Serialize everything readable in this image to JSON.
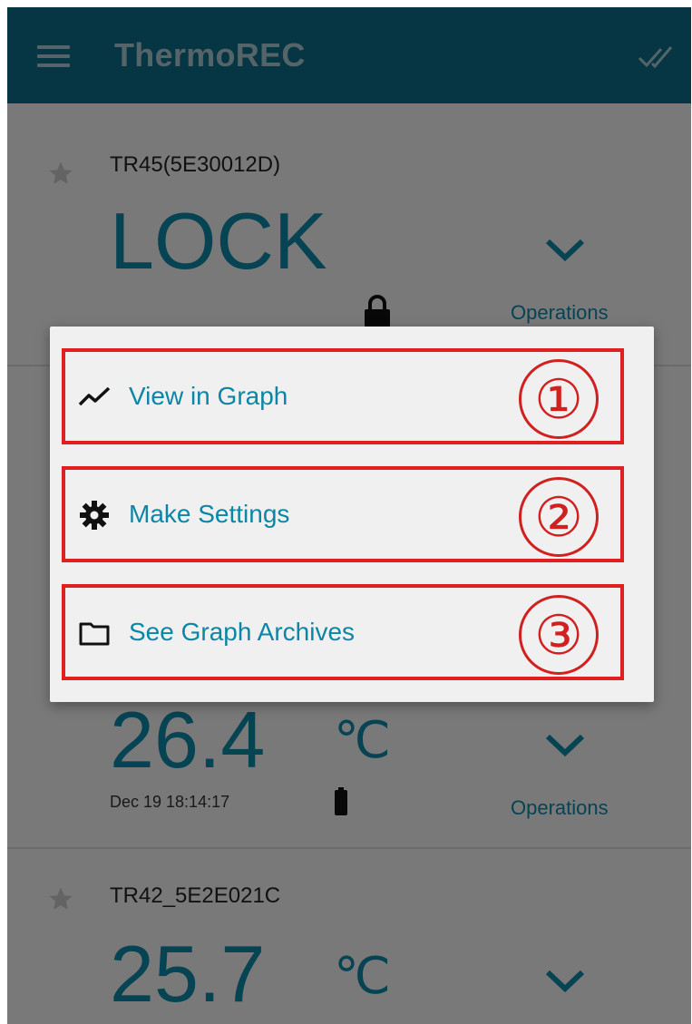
{
  "app": {
    "title": "ThermoREC",
    "icons": {
      "menu": "hamburger-icon",
      "sync": "double-check-icon"
    }
  },
  "devices": [
    {
      "name": "TR45(5E30012D)",
      "value": "LOCK",
      "unit": "",
      "timestamp": "",
      "status_icon": "lock-icon",
      "operations_label": "Operations"
    },
    {
      "name": "",
      "value": "26.4",
      "unit": "℃",
      "timestamp": "Dec 19 18:14:17",
      "status_icon": "battery-icon",
      "operations_label": "Operations"
    },
    {
      "name": "TR42_5E2E021C",
      "value": "25.7",
      "unit": "℃",
      "timestamp": "",
      "status_icon": "",
      "operations_label": ""
    }
  ],
  "menu": {
    "items": [
      {
        "label": "View in Graph",
        "icon": "graph-line-icon",
        "badge": "①"
      },
      {
        "label": "Make Settings",
        "icon": "gear-icon",
        "badge": "②"
      },
      {
        "label": "See Graph Archives",
        "icon": "folder-icon",
        "badge": "③"
      }
    ]
  },
  "colors": {
    "appbar": "#0d6d86",
    "accent": "#0c86a6",
    "highlight": "#e02020"
  }
}
